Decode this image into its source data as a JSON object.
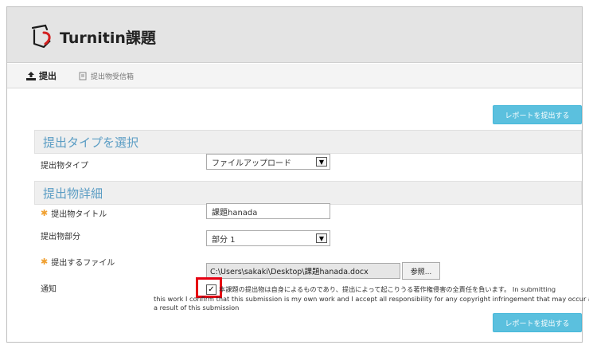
{
  "header": {
    "title": "Turnitin課題",
    "logo_icon": "turnitin-logo-icon"
  },
  "tabs": [
    {
      "label": "提出",
      "icon": "upload-icon"
    },
    {
      "label": "提出物受信箱",
      "icon": "inbox-icon"
    }
  ],
  "actions": {
    "submit_label": "レポートを提出する"
  },
  "section_type": {
    "title": "提出タイプを選択",
    "type_label": "提出物タイプ",
    "type_value": "ファイルアップロード"
  },
  "section_details": {
    "title": "提出物詳細",
    "title_label": "提出物タイトル",
    "title_value": "課題hanada",
    "part_label": "提出物部分",
    "part_value": "部分 1",
    "file_label": "提出するファイル",
    "file_path": "C:\\Users\\sakaki\\Desktop\\課題hanada.docx",
    "browse_label": "参照...",
    "notice_label": "通知",
    "notice_line1": "本課題の提出物は自身によるものであり、提出によって起こりうる著作権侵害の全責任を負います。 In submitting",
    "notice_line2": "this work I confirm that this submission is my own work and I accept all responsibility for any copyright infringement that may occur as",
    "notice_line3": "a result of this submission"
  },
  "colors": {
    "accent": "#5bc0de",
    "section_title": "#5b9dc4",
    "highlight": "#e60012",
    "required_star": "#f0a030"
  }
}
